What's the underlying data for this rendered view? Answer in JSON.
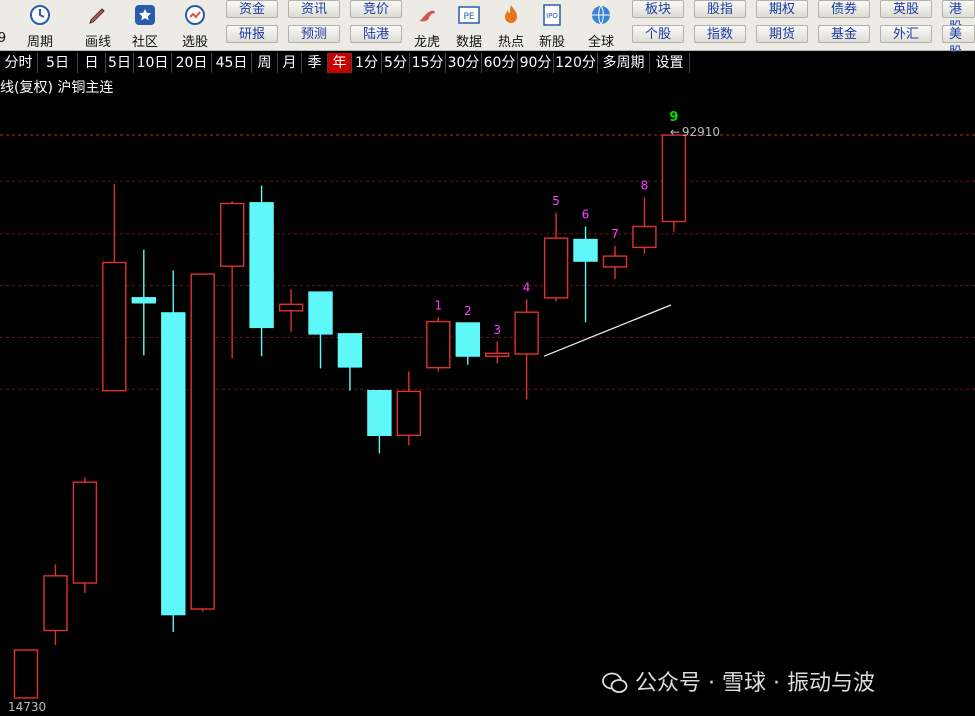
{
  "toolbar": {
    "tools": [
      {
        "label": "周期",
        "icon": "clock-icon"
      },
      {
        "label": "画线",
        "icon": "pen-icon"
      },
      {
        "label": "社区",
        "icon": "star-icon"
      },
      {
        "label": "选股",
        "icon": "stock-picker-icon"
      },
      {
        "label": "龙虎",
        "icon": "dragon-tiger-icon"
      },
      {
        "label": "数据",
        "icon": "pe-icon"
      },
      {
        "label": "热点",
        "icon": "hot-icon"
      },
      {
        "label": "新股",
        "icon": "ipo-icon"
      },
      {
        "label": "全球",
        "icon": "globe-icon"
      }
    ],
    "left_cut": "9",
    "buttons_row1": [
      "资金",
      "资讯",
      "竞价",
      "板块",
      "股指",
      "期权",
      "债券",
      "英股",
      "港股"
    ],
    "buttons_row2": [
      "研报",
      "预测",
      "陆港",
      "个股",
      "指数",
      "期货",
      "基金",
      "外汇",
      "美股"
    ]
  },
  "period_bar": {
    "items": [
      "分时",
      "5日",
      "日",
      "5日",
      "10日",
      "20日",
      "45日",
      "周",
      "月",
      "季",
      "年",
      "1分",
      "5分",
      "15分",
      "30分",
      "60分",
      "90分",
      "120分",
      "多周期",
      "设置"
    ],
    "active": "年"
  },
  "chart_info": {
    "kline_label": "线(复权)",
    "instrument": "沪铜主连"
  },
  "chart_data": {
    "type": "candlestick",
    "period": "年",
    "price_high_label": "92910",
    "price_low_label": "14730",
    "high_marker": "←",
    "up_color": "#e03030",
    "down_color": "#5ff8f8",
    "count_color": "#ff40ff",
    "count_final_color": "#00e000",
    "candles": [
      {
        "o": 14750,
        "c": 21400,
        "h": 21400,
        "l": 14730
      },
      {
        "o": 24100,
        "c": 31700,
        "h": 33300,
        "l": 22100
      },
      {
        "o": 30700,
        "c": 44700,
        "h": 45400,
        "l": 29300
      },
      {
        "o": 57400,
        "c": 75200,
        "h": 86100,
        "l": 57400
      },
      {
        "o": 70300,
        "c": 69600,
        "h": 77000,
        "l": 62300
      },
      {
        "o": 68200,
        "c": 26300,
        "h": 74100,
        "l": 23900
      },
      {
        "o": 27100,
        "c": 73600,
        "h": 73600,
        "l": 26700
      },
      {
        "o": 74700,
        "c": 83400,
        "h": 83700,
        "l": 61900
      },
      {
        "o": 83500,
        "c": 66200,
        "h": 85900,
        "l": 62200
      },
      {
        "o": 68500,
        "c": 69400,
        "h": 71500,
        "l": 65600
      },
      {
        "o": 71100,
        "c": 65300,
        "h": 71100,
        "l": 60500
      },
      {
        "o": 65300,
        "c": 60700,
        "h": 65300,
        "l": 57400
      },
      {
        "o": 57400,
        "c": 51200,
        "h": 57400,
        "l": 48700
      },
      {
        "o": 51200,
        "c": 57300,
        "h": 60100,
        "l": 49800
      },
      {
        "o": 60600,
        "c": 67000,
        "h": 67600,
        "l": 60100
      },
      {
        "o": 66800,
        "c": 62200,
        "h": 66800,
        "l": 61000
      },
      {
        "o": 62200,
        "c": 62600,
        "h": 64200,
        "l": 61200
      },
      {
        "o": 62500,
        "c": 68300,
        "h": 70100,
        "l": 56200
      },
      {
        "o": 70300,
        "c": 78600,
        "h": 82100,
        "l": 69800
      },
      {
        "o": 78400,
        "c": 75400,
        "h": 80200,
        "l": 66900
      },
      {
        "o": 74600,
        "c": 76100,
        "h": 77500,
        "l": 72900
      },
      {
        "o": 77300,
        "c": 80200,
        "h": 84200,
        "l": 76400
      },
      {
        "o": 80900,
        "c": 92900,
        "h": 92910,
        "l": 79500
      }
    ],
    "counts": [
      {
        "candle": 14,
        "label": "1"
      },
      {
        "candle": 15,
        "label": "2"
      },
      {
        "candle": 16,
        "label": "3"
      },
      {
        "candle": 17,
        "label": "4"
      },
      {
        "candle": 18,
        "label": "5"
      },
      {
        "candle": 19,
        "label": "6"
      },
      {
        "candle": 20,
        "label": "7"
      },
      {
        "candle": 21,
        "label": "8"
      },
      {
        "candle": 22,
        "label": "9"
      }
    ],
    "trendline": {
      "from_candle": 18,
      "from_price": 62200,
      "to_candle": 22,
      "to_price": 69300
    },
    "dashed_levels": [
      92910,
      86500,
      79200,
      72000,
      64800,
      57600
    ]
  },
  "watermark": {
    "text": "公众号 · 雪球 · 振动与波",
    "icon": "wechat-icon"
  }
}
